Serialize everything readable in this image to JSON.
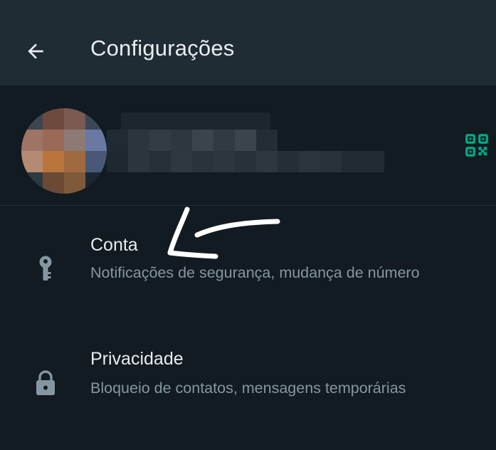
{
  "appbar": {
    "title": "Configurações",
    "back_icon": "arrow-back-icon",
    "background": "#1f2c34"
  },
  "profile": {
    "avatar": "pixelated-profile-photo",
    "name_redacted": true,
    "qr_icon": "qr-code-icon",
    "accent": "#00a884"
  },
  "settings": {
    "items": [
      {
        "icon": "key-icon",
        "title": "Conta",
        "subtitle": "Notificações de segurança, mudança de número"
      },
      {
        "icon": "lock-icon",
        "title": "Privacidade",
        "subtitle": "Bloqueio de contatos, mensagens temporárias"
      }
    ]
  },
  "annotation": {
    "type": "hand-drawn-arrow",
    "color": "#ffffff"
  },
  "colors": {
    "background": "#111b21",
    "primary_text": "#e9edef",
    "secondary_text": "#8696a0",
    "icon": "#8696a0"
  }
}
